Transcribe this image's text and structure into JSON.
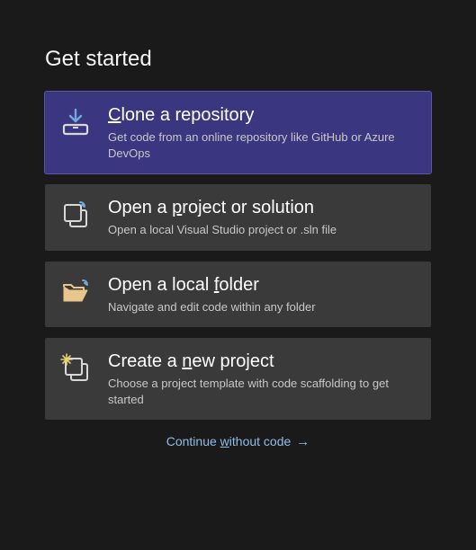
{
  "heading": "Get started",
  "options": [
    {
      "title_pre": "",
      "title_mn": "C",
      "title_post": "lone a repository",
      "desc": "Get code from an online repository like GitHub or Azure DevOps"
    },
    {
      "title_pre": "Open a ",
      "title_mn": "p",
      "title_post": "roject or solution",
      "desc": "Open a local Visual Studio project or .sln file"
    },
    {
      "title_pre": "Open a local ",
      "title_mn": "f",
      "title_post": "older",
      "desc": "Navigate and edit code within any folder"
    },
    {
      "title_pre": "Create a ",
      "title_mn": "n",
      "title_post": "ew project",
      "desc": "Choose a project template with code scaffolding to get started"
    }
  ],
  "continue_pre": "Continue ",
  "continue_mn": "w",
  "continue_post": "ithout code",
  "arrow": "→"
}
